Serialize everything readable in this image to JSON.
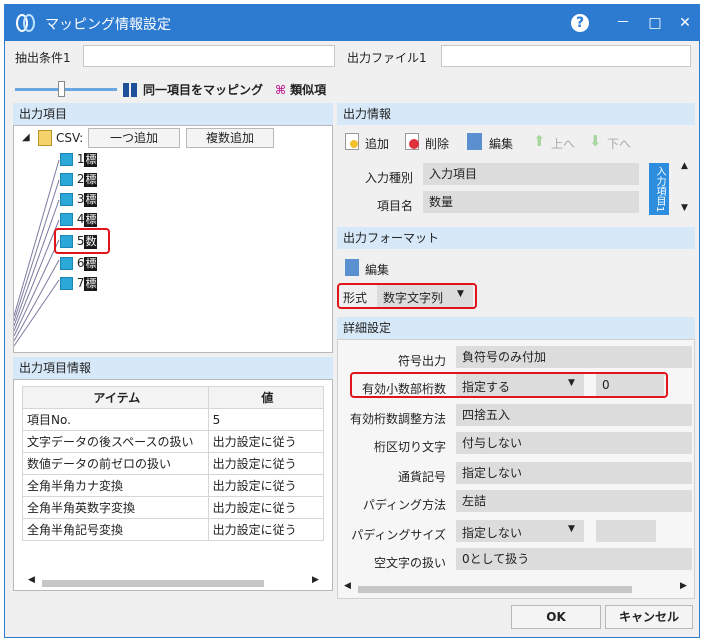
{
  "window": {
    "title": "マッピング情報設定",
    "help_icon": "?",
    "minimize_icon": "－",
    "maximize_icon": "□",
    "close_icon": "✕"
  },
  "top": {
    "extract_label": "抽出条件1",
    "extract_value": "",
    "output_file_label": "出力ファイル1",
    "output_file_value": ""
  },
  "toolbar": {
    "same_item_mapping": "同一項目をマッピング",
    "similar_item": "類似項",
    "slider_level": 0.4
  },
  "output_items": {
    "header": "出力項目",
    "root_label": "CSV:",
    "add_one_button": "一つ追加",
    "add_multiple_button": "複数追加",
    "items": [
      {
        "num": "1",
        "tag": "標"
      },
      {
        "num": "2",
        "tag": "標"
      },
      {
        "num": "3",
        "tag": "標"
      },
      {
        "num": "4",
        "tag": "標"
      },
      {
        "num": "5",
        "tag": "数"
      },
      {
        "num": "6",
        "tag": "標"
      },
      {
        "num": "7",
        "tag": "標"
      }
    ]
  },
  "item_info": {
    "header": "出力項目情報",
    "col_item": "アイテム",
    "col_value": "値",
    "rows": [
      {
        "item": "項目No.",
        "value": "5"
      },
      {
        "item": "文字データの後スペースの扱い",
        "value": "出力設定に従う"
      },
      {
        "item": "数値データの前ゼロの扱い",
        "value": "出力設定に従う"
      },
      {
        "item": "全角半角カナ変換",
        "value": "出力設定に従う"
      },
      {
        "item": "全角半角英数字変換",
        "value": "出力設定に従う"
      },
      {
        "item": "全角半角記号変換",
        "value": "出力設定に従う"
      }
    ]
  },
  "output_info": {
    "header": "出力情報",
    "add": "追加",
    "delete": "削除",
    "edit": "編集",
    "up": "上へ",
    "down": "下へ",
    "input_type_label": "入力種別",
    "input_type_value": "入力項目",
    "item_name_label": "項目名",
    "item_name_value": "数量",
    "side_tab": "入力項目1"
  },
  "output_format": {
    "header": "出力フォーマット",
    "edit": "編集",
    "format_label": "形式",
    "format_value": "数字文字列"
  },
  "detail": {
    "header": "詳細設定",
    "rows": [
      {
        "label": "符号出力",
        "value": "負符号のみ付加"
      },
      {
        "label": "有効小数部桁数",
        "value": "指定する",
        "extra": "0"
      },
      {
        "label": "有効桁数調整方法",
        "value": "四捨五入"
      },
      {
        "label": "桁区切り文字",
        "value": "付与しない"
      },
      {
        "label": "通貨記号",
        "value": "指定しない"
      },
      {
        "label": "パディング方法",
        "value": "左詰"
      },
      {
        "label": "パディングサイズ",
        "value": "指定しない",
        "extra": ""
      },
      {
        "label": "空文字の扱い",
        "value": "0として扱う"
      }
    ]
  },
  "footer": {
    "ok": "OK",
    "cancel": "キャンセル"
  }
}
